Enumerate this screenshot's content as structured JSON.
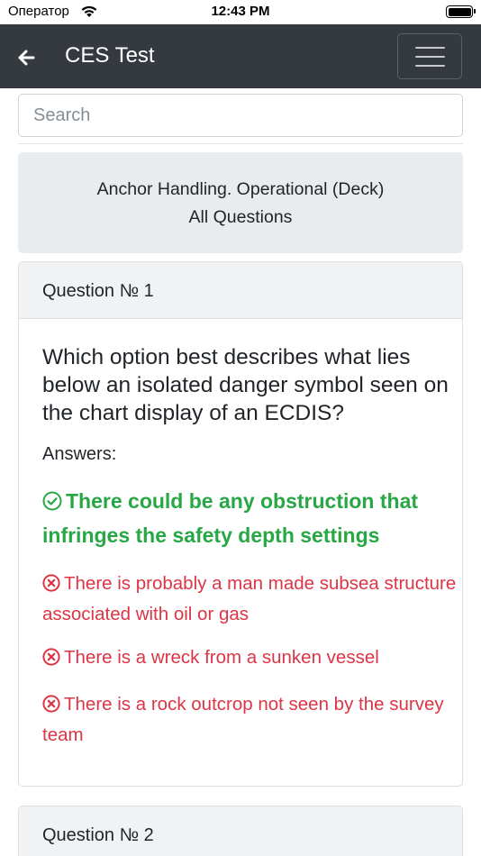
{
  "status_bar": {
    "carrier": "Оператор",
    "time": "12:43 PM"
  },
  "navbar": {
    "title": "CES Test",
    "back_icon": "arrow-left-icon",
    "menu_icon": "hamburger-menu-icon",
    "background": "#343a40"
  },
  "search": {
    "placeholder": "Search",
    "value": ""
  },
  "info": {
    "line1": "Anchor Handling. Operational (Deck)",
    "line2": "All Questions"
  },
  "questions": [
    {
      "number_label": "Question № 1",
      "text": "Which option best describes what lies below an isolated danger symbol seen on the chart display of an ECDIS?",
      "answers_label": "Answers:",
      "answers": [
        {
          "text": "There could be any obstruction that infringes the safety depth settings",
          "correct": true,
          "icon": "check-circle-icon"
        },
        {
          "text": "There is probably a man made subsea structure associated with oil or gas",
          "correct": false,
          "icon": "x-circle-icon"
        },
        {
          "text": "There is a wreck from a sunken vessel",
          "correct": false,
          "icon": "x-circle-icon"
        },
        {
          "text": "There is a rock outcrop not seen by the survey team",
          "correct": false,
          "icon": "x-circle-icon"
        }
      ]
    },
    {
      "number_label": "Question № 2"
    }
  ],
  "colors": {
    "correct": "#28a745",
    "wrong": "#dc3545"
  }
}
